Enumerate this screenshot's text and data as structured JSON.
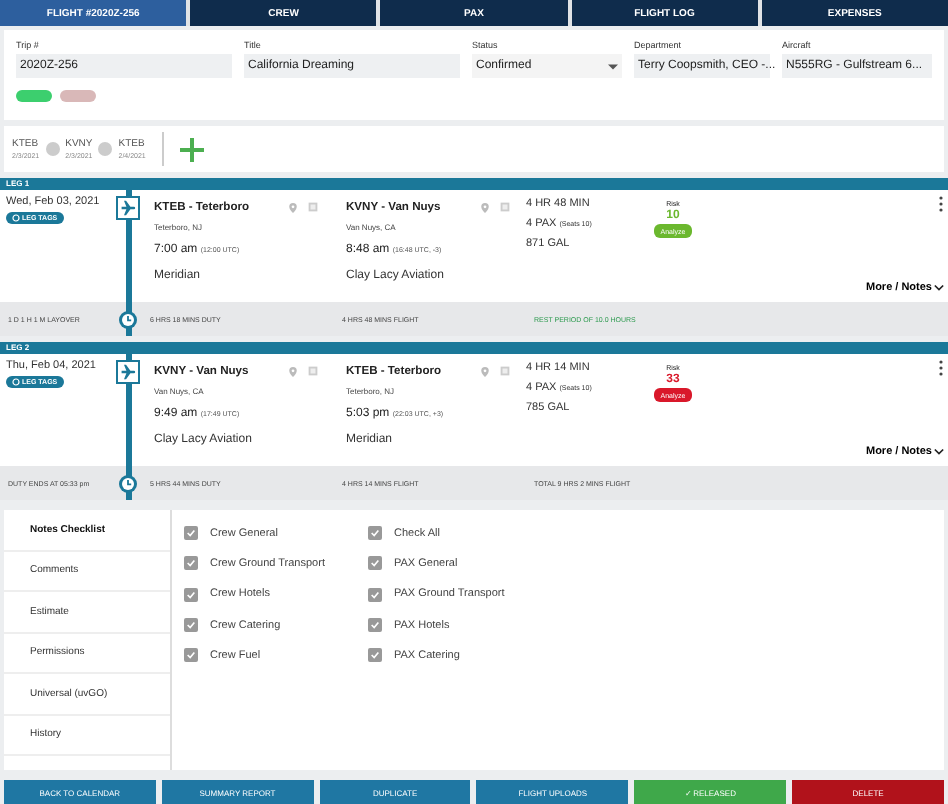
{
  "tabs": [
    {
      "label": "FLIGHT #2020Z-256",
      "selected": true
    },
    {
      "label": "CREW",
      "selected": false
    },
    {
      "label": "PAX",
      "selected": false
    },
    {
      "label": "FLIGHT LOG",
      "selected": false
    },
    {
      "label": "EXPENSES",
      "selected": false
    }
  ],
  "trip": {
    "fields": [
      {
        "label": "Trip #",
        "value": "2020Z-256",
        "kind": "text"
      },
      {
        "label": "Title",
        "value": "California Dreaming",
        "kind": "text"
      },
      {
        "label": "Status",
        "value": "Confirmed",
        "kind": "select"
      },
      {
        "label": "Department",
        "value": "Terry Coopsmith, CEO -...",
        "kind": "text"
      },
      {
        "label": "Aircraft",
        "value": "N555RG - Gulfstream 6...",
        "kind": "text"
      }
    ],
    "tags": [
      {
        "color": "#3ccf6e"
      },
      {
        "color": "#d9b8b8"
      }
    ]
  },
  "stops": [
    {
      "code": "KTEB",
      "date": "2/3/2021"
    },
    {
      "code": "KVNY",
      "date": "2/3/2021"
    },
    {
      "code": "KTEB",
      "date": "2/4/2021"
    }
  ],
  "legs": [
    {
      "title": "LEG 1",
      "date": "Wed, Feb 03, 2021",
      "tags_label": "LEG TAGS",
      "departure": {
        "airport": "KTEB - Teterboro",
        "city": "Teterboro, NJ",
        "time": "7:00 am",
        "utc": "(12:00 UTC)",
        "fbo": "Meridian"
      },
      "arrival": {
        "airport": "KVNY - Van Nuys",
        "city": "Van Nuys, CA",
        "time": "8:48 am",
        "utc": "(16:48 UTC, -3)",
        "fbo": "Clay Lacy Aviation"
      },
      "duration": "4 HR 48 MIN",
      "pax": "4 PAX",
      "seats": "(Seats 10)",
      "fuel": "871 GAL",
      "risk_label": "Risk",
      "risk": "10",
      "color": "#6bb82e",
      "analyze": "Analyze",
      "more": "More / Notes",
      "summary": [
        {
          "text": "1 D 1 H 1 M LAYOVER",
          "kind": "plain"
        },
        {
          "text": "6 HRS 18 MINS DUTY",
          "kind": "plain"
        },
        {
          "text": "4 HRS 48 MINS FLIGHT",
          "kind": "plain"
        },
        {
          "text": "REST PERIOD OF 10.0 HOURS",
          "kind": "rest"
        }
      ]
    },
    {
      "title": "LEG 2",
      "date": "Thu, Feb 04, 2021",
      "tags_label": "LEG TAGS",
      "departure": {
        "airport": "KVNY - Van Nuys",
        "city": "Van Nuys, CA",
        "time": "9:49 am",
        "utc": "(17:49 UTC)",
        "fbo": "Clay Lacy Aviation"
      },
      "arrival": {
        "airport": "KTEB - Teterboro",
        "city": "Teterboro, NJ",
        "time": "5:03 pm",
        "utc": "(22:03 UTC, +3)",
        "fbo": "Meridian"
      },
      "duration": "4 HR 14 MIN",
      "pax": "4 PAX",
      "seats": "(Seats 10)",
      "fuel": "785 GAL",
      "risk_label": "Risk",
      "risk": "33",
      "color": "#d9182a",
      "analyze": "Analyze",
      "more": "More / Notes",
      "summary": [
        {
          "text": "DUTY ENDS AT 05:33 pm",
          "kind": "plain"
        },
        {
          "text": "5 HRS 44 MINS DUTY",
          "kind": "plain"
        },
        {
          "text": "4 HRS 14 MINS FLIGHT",
          "kind": "plain"
        },
        {
          "text": "TOTAL 9 HRS 2 MINS FLIGHT",
          "kind": "plain"
        }
      ]
    }
  ],
  "notes": {
    "menu": [
      {
        "label": "Notes Checklist",
        "selected": true
      },
      {
        "label": "Comments",
        "selected": false
      },
      {
        "label": "Estimate",
        "selected": false
      },
      {
        "label": "Permissions",
        "selected": false
      },
      {
        "label": "Universal (uvGO)",
        "selected": false
      },
      {
        "label": "History",
        "selected": false
      }
    ],
    "checklist": [
      [
        {
          "label": "Crew General",
          "checked": true
        },
        {
          "label": "Crew Ground Transport",
          "checked": true
        },
        {
          "label": "Crew Hotels",
          "checked": true
        },
        {
          "label": "Crew Catering",
          "checked": true
        },
        {
          "label": "Crew Fuel",
          "checked": true
        }
      ],
      [
        {
          "label": "Check All",
          "checked": true
        },
        {
          "label": "PAX General",
          "checked": true
        },
        {
          "label": "PAX Ground Transport",
          "checked": true
        },
        {
          "label": "PAX Hotels",
          "checked": true
        },
        {
          "label": "PAX Catering",
          "checked": true
        }
      ]
    ]
  },
  "actions": [
    {
      "label": "BACK TO CALENDAR",
      "kind": "normal"
    },
    {
      "label": "SUMMARY REPORT",
      "kind": "normal"
    },
    {
      "label": "DUPLICATE",
      "kind": "normal"
    },
    {
      "label": "FLIGHT UPLOADS",
      "kind": "normal"
    },
    {
      "label": "✓ RELEASED",
      "kind": "success"
    },
    {
      "label": "DELETE",
      "kind": "danger"
    }
  ]
}
